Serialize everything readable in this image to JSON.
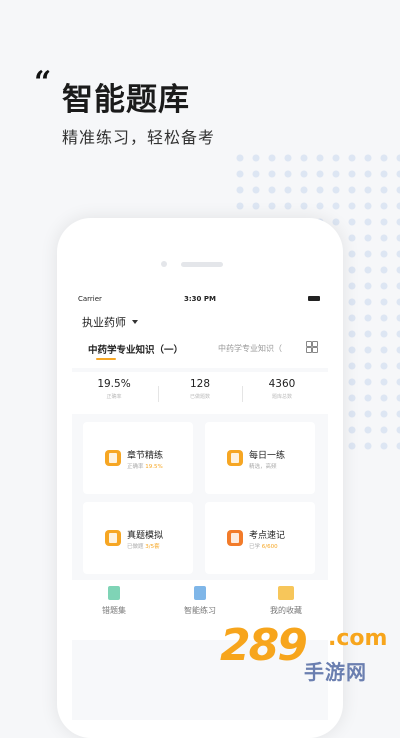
{
  "hero": {
    "quote_mark": "“",
    "title": "智能题库",
    "subtitle": "精准练习，轻松备考"
  },
  "status_bar": {
    "carrier": "Carrier",
    "time": "3:30 PM"
  },
  "header": {
    "exam_select": "执业药师",
    "tabs": [
      {
        "label": "中药学专业知识（一）",
        "active": true
      },
      {
        "label": "中药学专业知识（",
        "active": false
      }
    ]
  },
  "stats": [
    {
      "value": "19.5%",
      "label": "正确率"
    },
    {
      "value": "128",
      "label": "已做题数"
    },
    {
      "value": "4360",
      "label": "题库总数"
    }
  ],
  "cards": [
    {
      "title": "章节精练",
      "sub_prefix": "正确率",
      "sub_highlight": "19.5%",
      "icon": "book-icon",
      "color": "#f6a623"
    },
    {
      "title": "每日一练",
      "sub_prefix": "精选，高频",
      "sub_highlight": "",
      "icon": "calendar-icon",
      "color": "#f6a623"
    },
    {
      "title": "真题模拟",
      "sub_prefix": "已做题",
      "sub_highlight": "3/5套",
      "icon": "document-icon",
      "color": "#f6a623"
    },
    {
      "title": "考点速记",
      "sub_prefix": "已学",
      "sub_highlight": "6/600",
      "icon": "notebook-icon",
      "color": "#f27b2a"
    }
  ],
  "bottom_nav": [
    {
      "label": "错题集",
      "icon": "wrong-questions-icon",
      "color": "#7fd4b6"
    },
    {
      "label": "智能练习",
      "icon": "smart-practice-icon",
      "color": "#7fb6e8"
    },
    {
      "label": "我的收藏",
      "icon": "favorites-folder-icon",
      "color": "#f7c65a"
    }
  ],
  "watermark": {
    "number": "289",
    "domain": ".com",
    "name": "手游网"
  }
}
